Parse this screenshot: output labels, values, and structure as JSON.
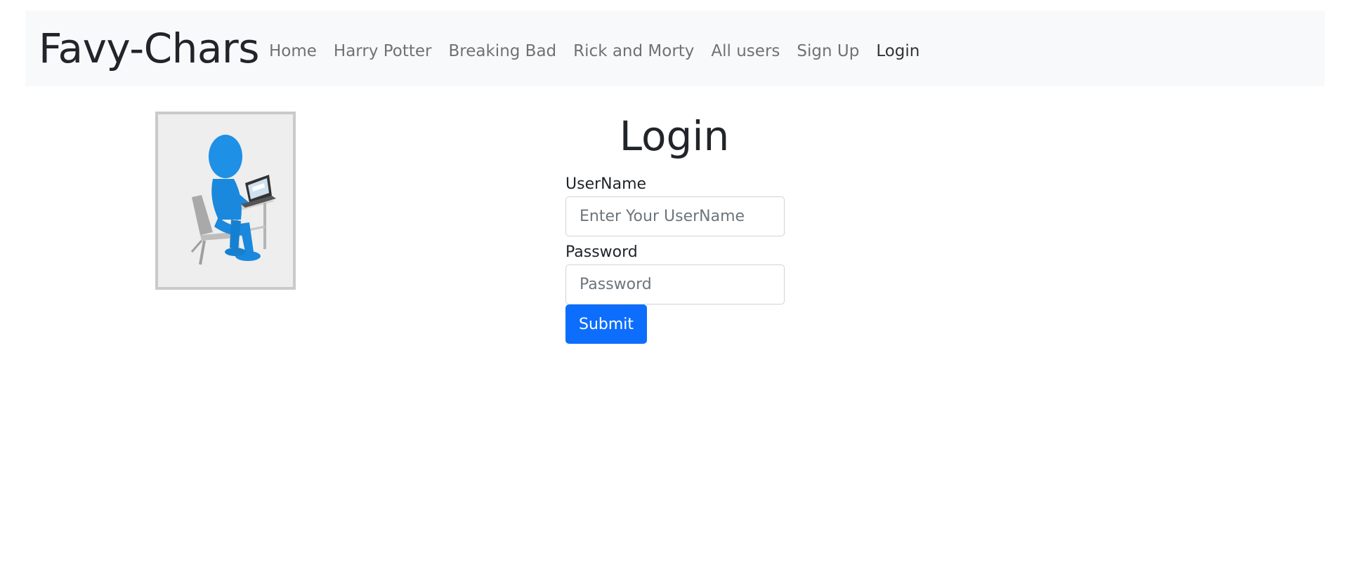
{
  "navbar": {
    "brand": "Favy-Chars",
    "links": [
      {
        "label": "Home"
      },
      {
        "label": "Harry Potter"
      },
      {
        "label": "Breaking Bad"
      },
      {
        "label": "Rick and Morty"
      },
      {
        "label": "All users"
      },
      {
        "label": "Sign Up"
      },
      {
        "label": "Login"
      }
    ]
  },
  "main": {
    "title": "Login",
    "form": {
      "username_label": "UserName",
      "username_placeholder": "Enter Your UserName",
      "username_value": "",
      "password_label": "Password",
      "password_placeholder": "Password",
      "password_value": "",
      "submit_label": "Submit"
    }
  },
  "colors": {
    "navbar_bg": "#f8f9fa",
    "primary": "#0d6efd",
    "figure": "#1e90e6"
  }
}
